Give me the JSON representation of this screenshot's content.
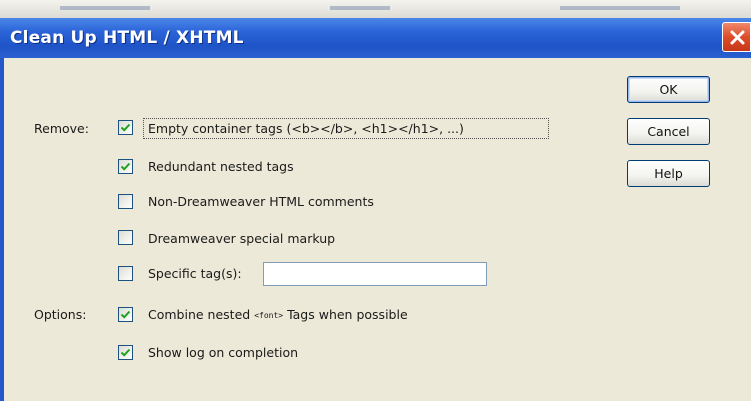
{
  "window": {
    "title": "Clean Up HTML / XHTML"
  },
  "remove_section": {
    "label": "Remove:",
    "options": [
      {
        "label": "Empty container tags (<b></b>, <h1></h1>, ...)",
        "checked": true
      },
      {
        "label": "Redundant nested tags",
        "checked": true
      },
      {
        "label": "Non-Dreamweaver HTML comments",
        "checked": false
      },
      {
        "label": "Dreamweaver special markup",
        "checked": false
      },
      {
        "label": "Specific tag(s):",
        "checked": false,
        "input_value": ""
      }
    ]
  },
  "options_section": {
    "label": "Options:",
    "combine": {
      "prefix": "Combine nested",
      "tag": "<font>",
      "suffix": "Tags when possible",
      "checked": true
    },
    "show_log": {
      "label": "Show log on completion",
      "checked": true
    }
  },
  "buttons": {
    "ok": "OK",
    "cancel": "Cancel",
    "help": "Help"
  }
}
